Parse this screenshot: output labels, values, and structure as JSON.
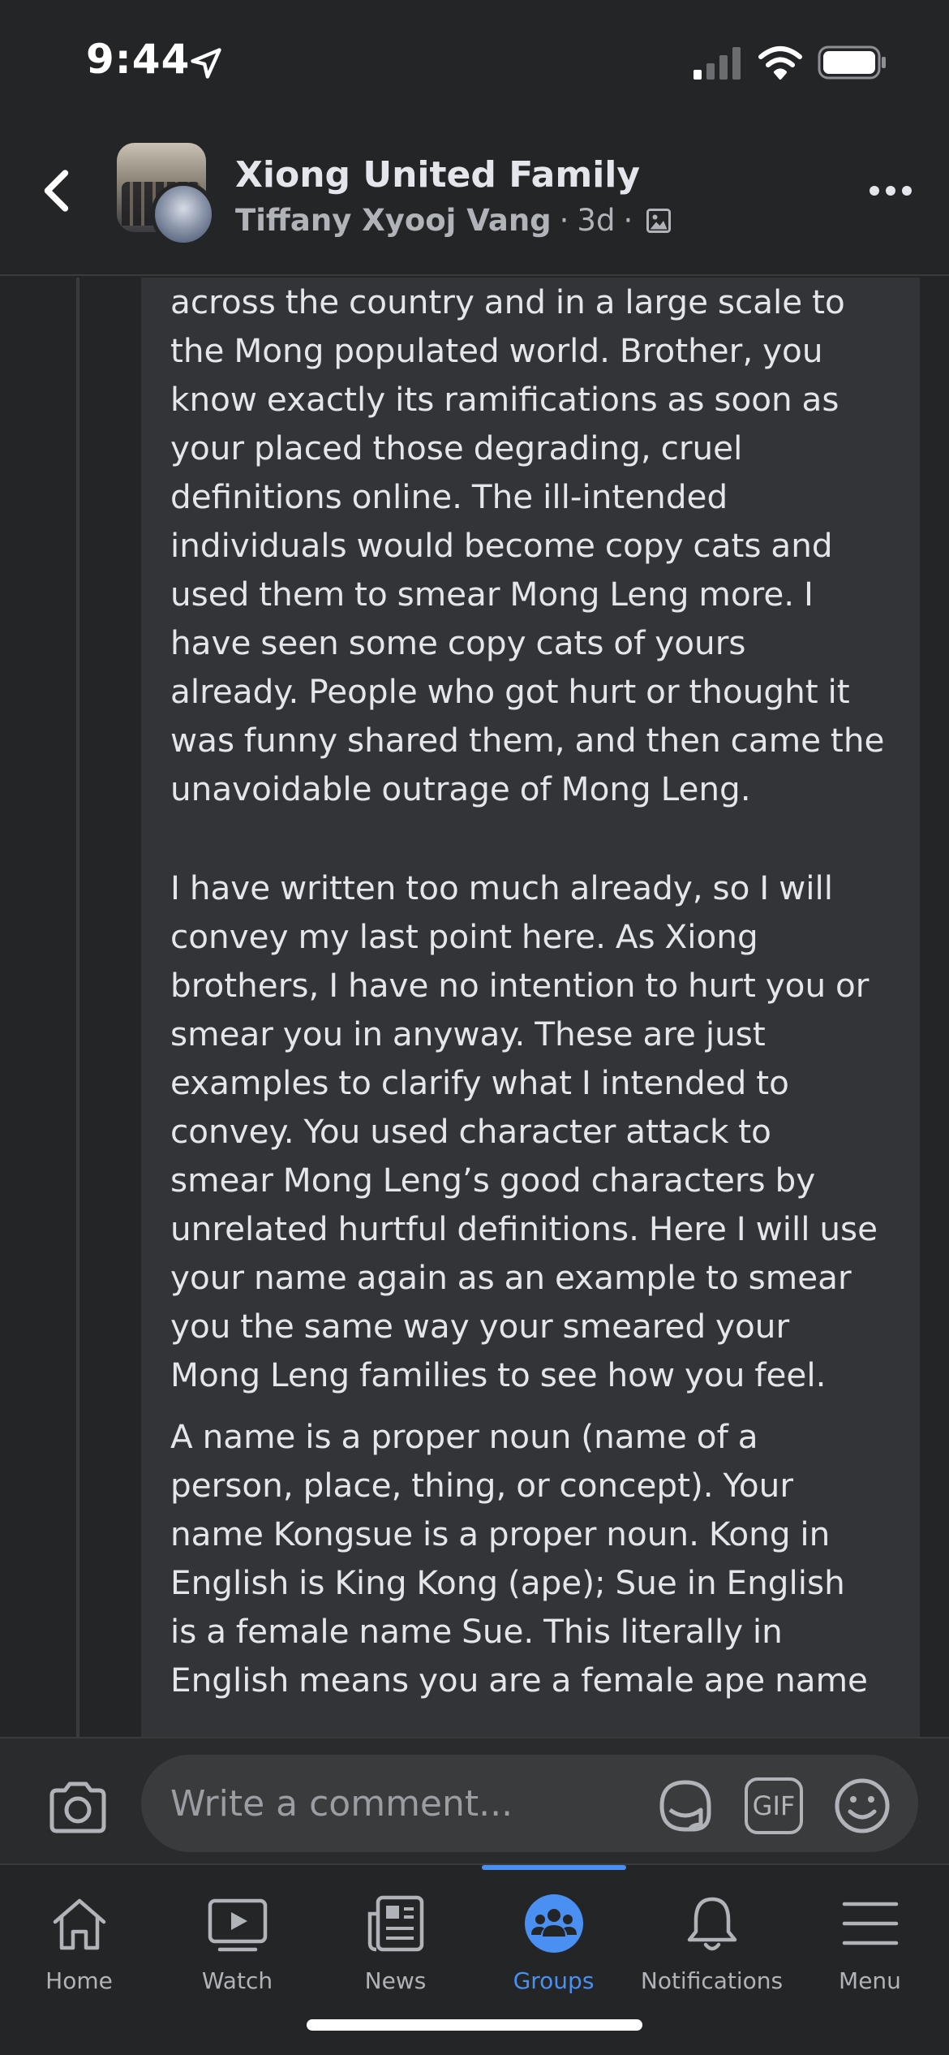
{
  "status_bar": {
    "time": "9:44"
  },
  "header": {
    "group_name": "Xiong United Family",
    "author": "Tiffany Xyooj Vang",
    "separator": "·",
    "time_ago": "3d",
    "icons": [
      "back-icon",
      "location-icon",
      "photo-privacy-icon",
      "more-icon"
    ]
  },
  "comment": {
    "paragraph_1": "across the country and in a large scale to\nthe Mong populated world. Brother, you\nknow exactly its ramifications as soon as\nyour placed those degrading, cruel\ndefinitions online. The ill-intended\nindividuals would become copy cats and\nused them to smear Mong Leng more. I\nhave seen some copy cats of yours\nalready. People who got hurt or thought it\nwas funny shared them, and then came the\nunavoidable outrage of Mong Leng.",
    "paragraph_2": "I have written too much already, so I will\nconvey my last point here. As Xiong\nbrothers, I have no intention to hurt you or\nsmear you in anyway. These are just\nexamples to clarify what I intended to\nconvey. You used character attack to\nsmear Mong Leng’s good characters by\nunrelated hurtful definitions. Here I will use\nyour name again as an example to smear\nyou the same way your smeared your\nMong Leng families to see how you feel.",
    "paragraph_3": "A name is a proper noun (name of a\nperson, place, thing, or concept). Your\nname Kongsue is a proper noun. Kong in\nEnglish is King Kong (ape); Sue in English\nis a female name Sue. This literally in\nEnglish means you are a female ape name"
  },
  "composer": {
    "placeholder": "Write a comment...",
    "gif_label": "GIF"
  },
  "tabs": [
    {
      "label": "Home",
      "icon": "home-icon",
      "active": false
    },
    {
      "label": "Watch",
      "icon": "watch-icon",
      "active": false
    },
    {
      "label": "News",
      "icon": "news-icon",
      "active": false
    },
    {
      "label": "Groups",
      "icon": "groups-icon",
      "active": true
    },
    {
      "label": "Notifications",
      "icon": "bell-icon",
      "active": false
    },
    {
      "label": "Menu",
      "icon": "menu-icon",
      "active": false
    }
  ],
  "colors": {
    "background": "#242527",
    "bubble": "#333437",
    "accent": "#4a8ff2",
    "text": "#e4e6eb",
    "secondary_text": "#b0b3b8"
  }
}
